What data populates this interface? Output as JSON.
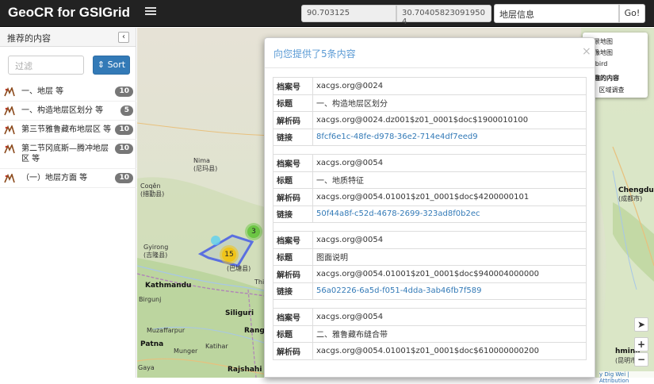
{
  "app": {
    "brand": "GeoCR for GSIGrid"
  },
  "navbar": {
    "longitude": "90.703125",
    "latitude": "30.70405823091950​4",
    "search_value": "地层信息",
    "go_label": "Go!"
  },
  "sidebar": {
    "title": "推荐的内容",
    "collapse_icon": "‹",
    "filter_placeholder": "过滤",
    "sort_label": "⇕ Sort",
    "items": [
      {
        "label": "一、地层 等",
        "count": "10"
      },
      {
        "label": "一、构造地层区划分 等",
        "count": "5"
      },
      {
        "label": "第三节雅鲁藏布地层区 等",
        "count": "10"
      },
      {
        "label": "第二节冈底斯—腾冲地层区 等",
        "count": "10"
      },
      {
        "label": "（一）地层方面 等",
        "count": "10"
      }
    ]
  },
  "layers": {
    "items": [
      "街景地图",
      "影像地图",
      "hybird"
    ],
    "section_title": "兴趣的内容",
    "section_item": "区域调查"
  },
  "map": {
    "clusters": [
      {
        "count": "3",
        "color": "#6cc644"
      },
      {
        "count": "15",
        "color": "#f0c419"
      }
    ],
    "labels": [
      "Nima",
      "(尼玛县)",
      "Gyirong",
      "(吉隆县)",
      "Kathmandu",
      "Birgunj",
      "Muzaffarpur",
      "Patna",
      "Munger",
      "Katihar",
      "Siliguri",
      "Rangp",
      "Rajshahi",
      "Gaya",
      "Thin",
      "Chengdu",
      "(成都市)",
      "hming",
      "(昆明市)",
      "(巴塘县)",
      "Coqên",
      "(措勤县)"
    ],
    "attribution": "y Dig Wei | Attribution"
  },
  "modal": {
    "title": "向您提供了5条内容",
    "close_icon": "×",
    "records": [
      {
        "archive_label": "档案号",
        "archive": "xacgs.org@0024",
        "title_label": "标题",
        "title": "一、构造地层区划分",
        "code_label": "解析码",
        "code": "xacgs.org@0024.dz001$z01_0001$doc$1900010100",
        "link_label": "链接",
        "link": "8fcf6e1c-48fe-d978-36e2-714e4df7eed9"
      },
      {
        "archive_label": "档案号",
        "archive": "xacgs.org@0054",
        "title_label": "标题",
        "title": "一、地质特征",
        "code_label": "解析码",
        "code": "xacgs.org@0054.01001$z01_0001$doc$4200000101",
        "link_label": "链接",
        "link": "50f44a8f-c52d-4678-2699-323ad8f0b2ec"
      },
      {
        "archive_label": "档案号",
        "archive": "xacgs.org@0054",
        "title_label": "标题",
        "title": "图面说明",
        "code_label": "解析码",
        "code": "xacgs.org@0054.01001$z01_0001$doc$940004000000",
        "link_label": "链接",
        "link": "56a02226-6a5d-f051-4dda-3ab46fb7f589"
      },
      {
        "archive_label": "档案号",
        "archive": "xacgs.org@0054",
        "title_label": "标题",
        "title": "二、雅鲁藏布缝合带",
        "code_label": "解析码",
        "code": "xacgs.org@0054.01001$z01_0001$doc$610000000200"
      }
    ]
  },
  "controls": {
    "locate_icon": "➤",
    "zoom_in": "+",
    "zoom_out": "−"
  },
  "colors": {
    "navbar": "#222222",
    "accent": "#337ab7",
    "modal_title": "#5b9bd5"
  }
}
